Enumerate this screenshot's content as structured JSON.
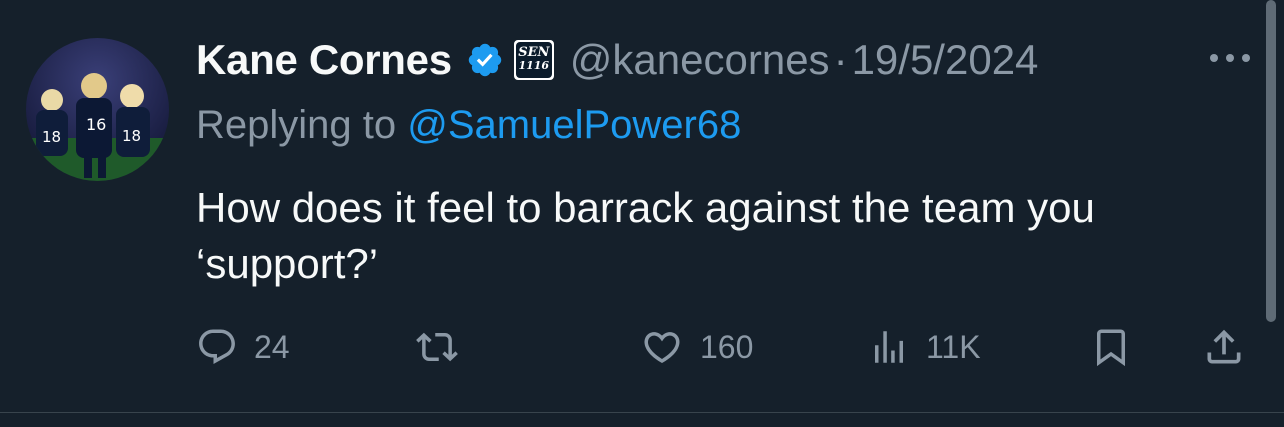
{
  "tweet": {
    "author": {
      "display_name": "Kane Cornes",
      "handle": "@kanecornes",
      "verified": true,
      "affiliate_badge": {
        "line1": "SEN",
        "line2": "1116"
      },
      "avatar": "avatar-photo"
    },
    "separator": "·",
    "timestamp": "19/5/2024",
    "reply_prefix": "Replying to",
    "reply_to": "@SamuelPower68",
    "text": "How does it feel to barrack against the team you ‘support?’"
  },
  "actions": {
    "reply": {
      "icon": "reply-icon",
      "count": "24"
    },
    "retweet": {
      "icon": "retweet-icon",
      "count": ""
    },
    "like": {
      "icon": "heart-icon",
      "count": "160"
    },
    "views": {
      "icon": "views-icon",
      "count": "11K"
    },
    "bookmark": {
      "icon": "bookmark-icon"
    },
    "share": {
      "icon": "share-icon"
    }
  },
  "colors": {
    "background": "#15202b",
    "text_primary": "#f7f9f9",
    "text_secondary": "#8b98a5",
    "accent": "#1d9bf0",
    "divider": "#38444d"
  }
}
